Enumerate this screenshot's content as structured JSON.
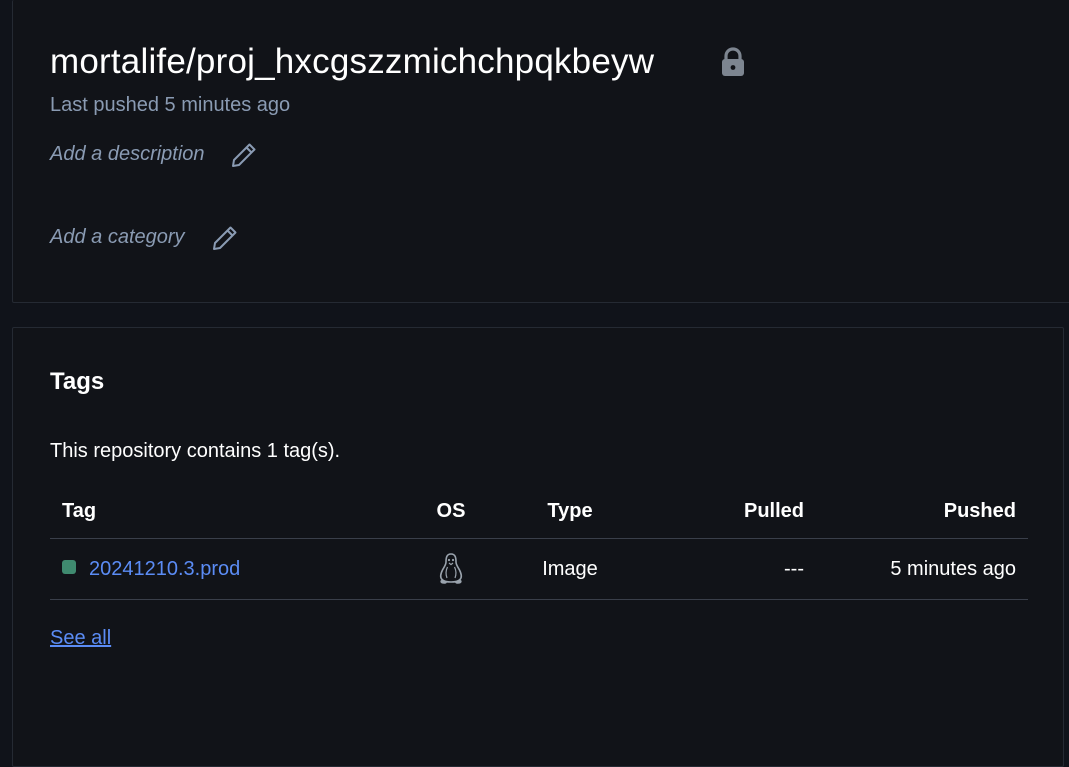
{
  "repository": {
    "name": "mortalife/proj_hxcgszzmichchpqkbeyw",
    "visibility_icon": "lock-icon",
    "last_pushed": "Last pushed 5 minutes ago",
    "add_description": "Add a description",
    "add_category": "Add a category"
  },
  "tags": {
    "heading": "Tags",
    "count_text": "This repository contains 1 tag(s).",
    "columns": {
      "tag": "Tag",
      "os": "OS",
      "type": "Type",
      "pulled": "Pulled",
      "pushed": "Pushed"
    },
    "rows": [
      {
        "tag": "20241210.3.prod",
        "os_icon": "linux-icon",
        "type": "Image",
        "pulled": "---",
        "pushed": "5 minutes ago",
        "status_color": "#3f8a6f"
      }
    ],
    "see_all": "See all"
  },
  "colors": {
    "background": "#111318",
    "muted_text": "#8a9bb3",
    "link": "#5b8cf5"
  }
}
